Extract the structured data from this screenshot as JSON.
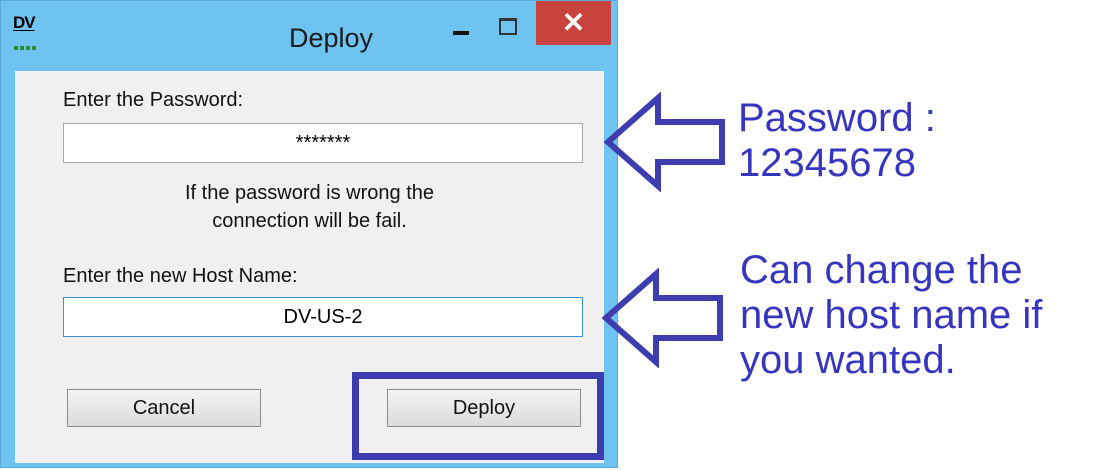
{
  "window": {
    "title": "Deploy",
    "app_icon_text": "DV",
    "close_glyph": "✕"
  },
  "form": {
    "password_label": "Enter the Password:",
    "password_value": "*******",
    "warning_line1": "If the password is wrong the",
    "warning_line2": "connection will be fail.",
    "host_label": "Enter the new Host Name:",
    "host_value": "DV-US-2",
    "cancel_label": "Cancel",
    "deploy_label": "Deploy"
  },
  "annotations": {
    "password_line1": "Password :",
    "password_line2": "12345678",
    "host_line1": "Can change the",
    "host_line2": "new host name if",
    "host_line3": "you wanted."
  },
  "colors": {
    "titlebar": "#6fc3f1",
    "close_button": "#c8433e",
    "annotation": "#3535c0"
  },
  "icons": [
    "app-logo-icon",
    "minimize-icon",
    "maximize-icon",
    "close-icon",
    "left-arrow-icon"
  ]
}
